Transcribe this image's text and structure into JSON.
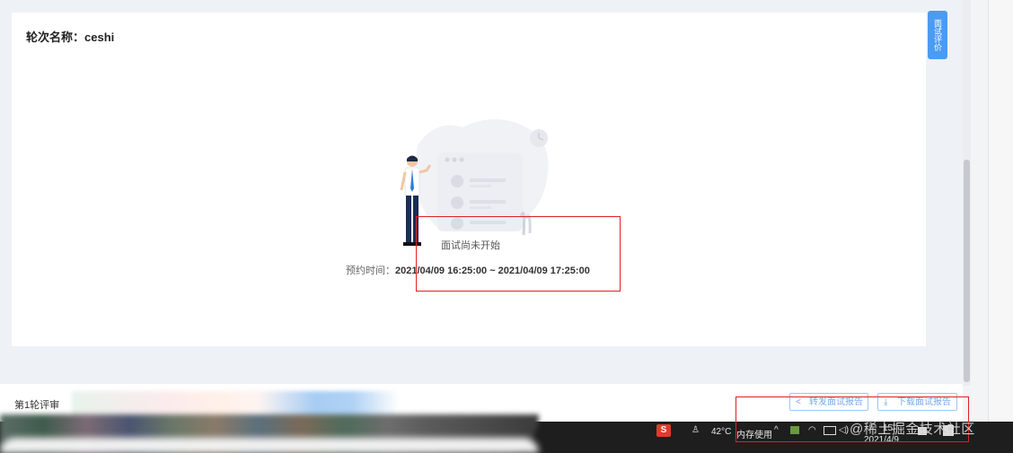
{
  "page": {
    "round_name": "轮次名称：ceshi",
    "eval_tab": "面试评价",
    "status": "面试尚未开始",
    "time_label": "预约时间：",
    "time_value": "2021/04/09 16:25:00 ~ 2021/04/09 17:25:00"
  },
  "bottom": {
    "round_label": "第1轮评审",
    "share_button": "转发面试报告",
    "download_button": "下载面试报告"
  },
  "taskbar": {
    "ime": "S",
    "temperature": "42°C",
    "memory": "内存使用",
    "date": "2021/4/9",
    "time_partial": "15"
  },
  "watermark": "@稀土掘金技术社区",
  "colors": {
    "accent": "#4a9bf3",
    "highlight_box": "#e02020",
    "button_border": "#9ec5f2"
  },
  "icons": {
    "share": "share-icon",
    "download": "download-icon"
  }
}
